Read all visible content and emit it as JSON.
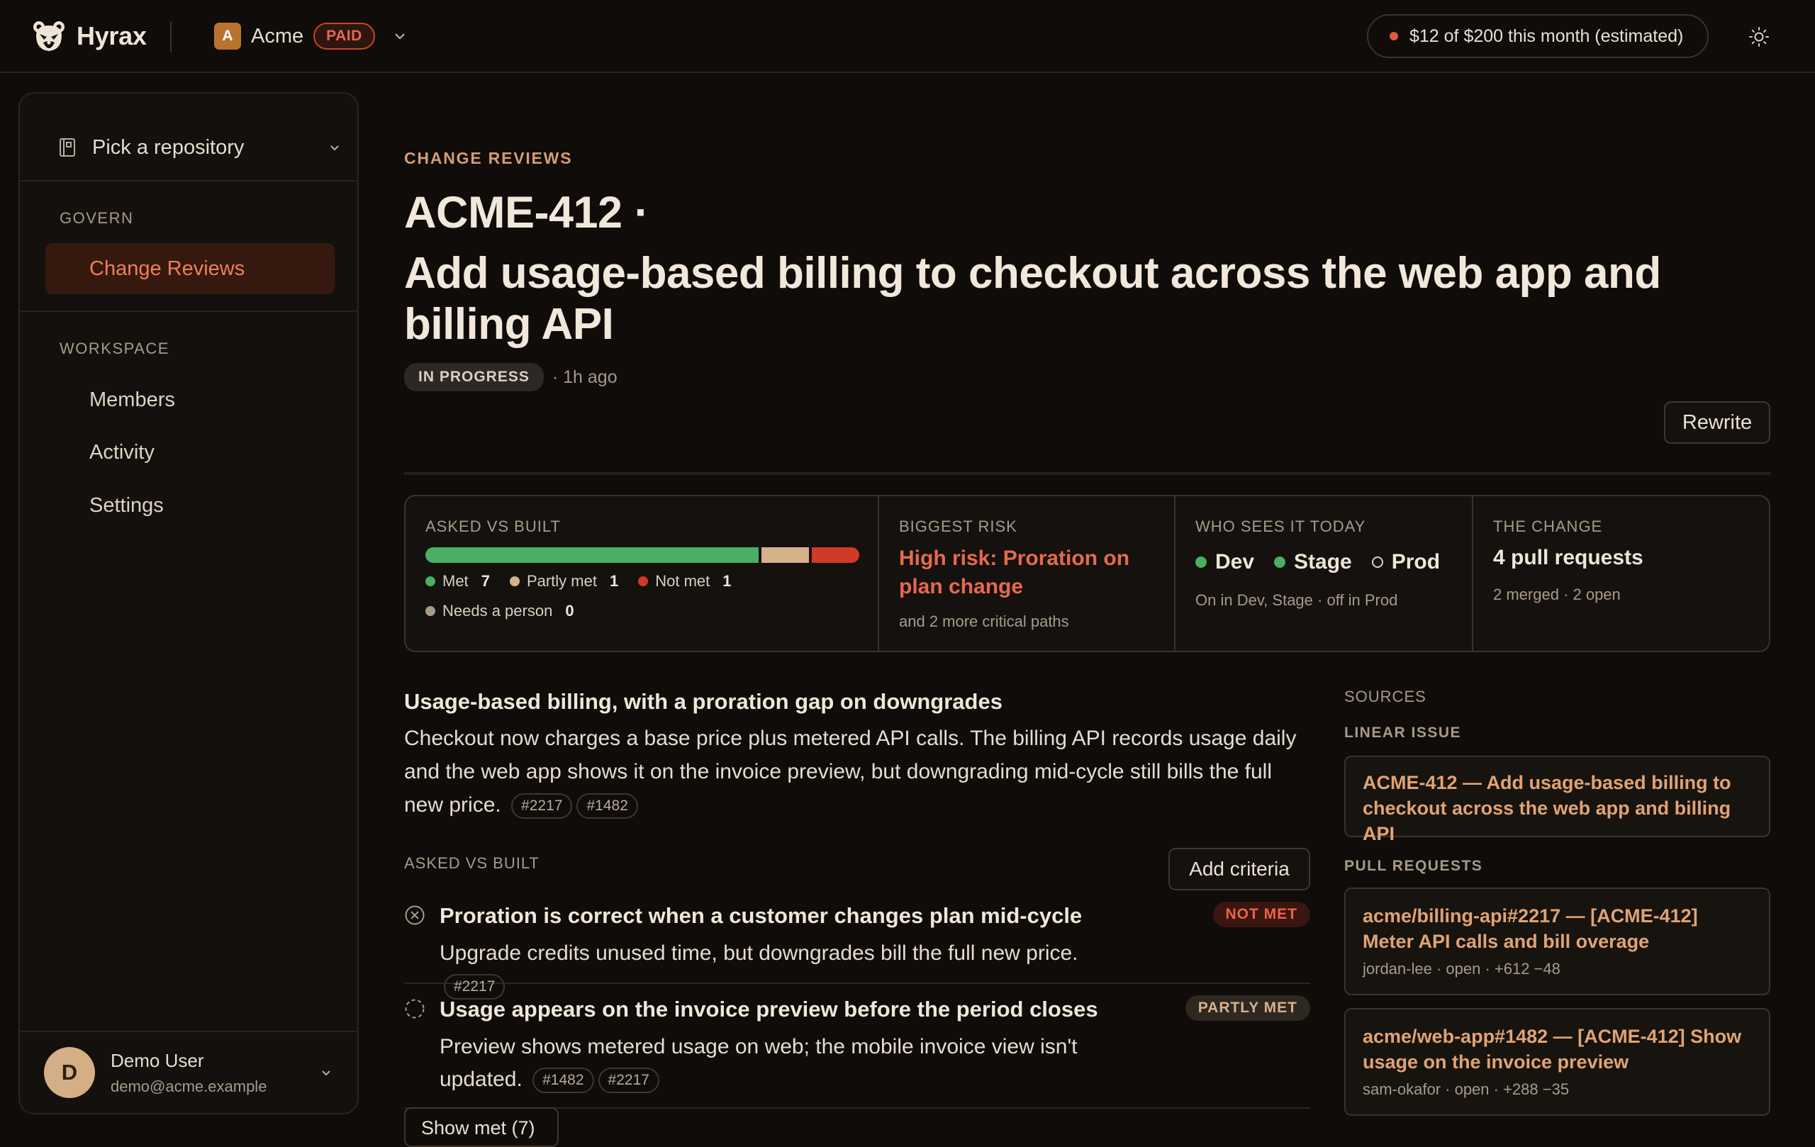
{
  "app": {
    "name": "Hyrax"
  },
  "org": {
    "initial": "A",
    "name": "Acme",
    "plan_badge": "PAID"
  },
  "budget": {
    "text": "$12 of $200 this month (estimated)"
  },
  "sidebar": {
    "repo_picker": "Pick a repository",
    "govern_label": "GOVERN",
    "govern_items": [
      {
        "label": "Change Reviews"
      }
    ],
    "workspace_label": "WORKSPACE",
    "workspace_items": [
      {
        "label": "Members"
      },
      {
        "label": "Activity"
      },
      {
        "label": "Settings"
      }
    ],
    "user": {
      "initial": "D",
      "name": "Demo User",
      "email": "demo@acme.example"
    }
  },
  "header": {
    "kicker": "CHANGE REVIEWS",
    "ticket": "ACME-412 ·",
    "title": "Add usage-based billing to checkout across the web app and billing API",
    "status": "IN PROGRESS",
    "time": "· 1h ago",
    "rewrite_label": "Rewrite"
  },
  "summary": {
    "asked_label": "ASKED VS BUILT",
    "progress": {
      "met": 7,
      "partly": 1,
      "not_met": 1
    },
    "legend": [
      {
        "label": "Met",
        "count": "7",
        "color": "#4cae62"
      },
      {
        "label": "Partly met",
        "count": "1",
        "color": "#d7b08c"
      },
      {
        "label": "Not met",
        "count": "1",
        "color": "#d23a28"
      },
      {
        "label": "Needs a person",
        "count": "0",
        "color": "#a89a8b"
      }
    ],
    "risk_label": "BIGGEST RISK",
    "risk_title": "High risk: Proration on plan change",
    "risk_sub": "and 2 more critical paths",
    "who_label": "WHO SEES IT TODAY",
    "envs": [
      {
        "label": "Dev",
        "on": true
      },
      {
        "label": "Stage",
        "on": true
      },
      {
        "label": "Prod",
        "on": false
      }
    ],
    "who_sub": "On in Dev, Stage · off in Prod",
    "change_label": "THE CHANGE",
    "change_title": "4 pull requests",
    "change_sub": "2 merged · 2 open"
  },
  "description": {
    "title": "Usage-based billing, with a proration gap on downgrades",
    "body": "Checkout now charges a base price plus metered API calls. The billing API records usage daily and the web app shows it on the invoice preview, but downgrading mid-cycle still bills the full new price.",
    "chips": [
      "#2217",
      "#1482"
    ]
  },
  "criteria": {
    "label": "ASKED VS BUILT",
    "add_label": "Add criteria",
    "items": [
      {
        "title": "Proration is correct when a customer changes plan mid-cycle",
        "body": "Upgrade credits unused time, but downgrades bill the full new price.",
        "chips": [
          "#2217"
        ],
        "badge": "NOT MET"
      },
      {
        "title": "Usage appears on the invoice preview before the period closes",
        "body": "Preview shows metered usage on web; the mobile invoice view isn't updated.",
        "chips": [
          "#1482",
          "#2217"
        ],
        "badge": "PARTLY MET"
      }
    ],
    "show_met_label": "Show met (7)"
  },
  "sources": {
    "label": "SOURCES",
    "linear_label": "LINEAR ISSUE",
    "linear_title": "ACME-412 — Add usage-based billing to checkout across the web app and billing API",
    "prs_label": "PULL REQUESTS",
    "prs": [
      {
        "title": "acme/billing-api#2217 — [ACME-412] Meter API calls and bill overage",
        "meta": "jordan-lee · open · +612 −48"
      },
      {
        "title": "acme/web-app#1482 — [ACME-412] Show usage on the invoice preview",
        "meta": "sam-okafor · open · +288 −35"
      }
    ]
  }
}
